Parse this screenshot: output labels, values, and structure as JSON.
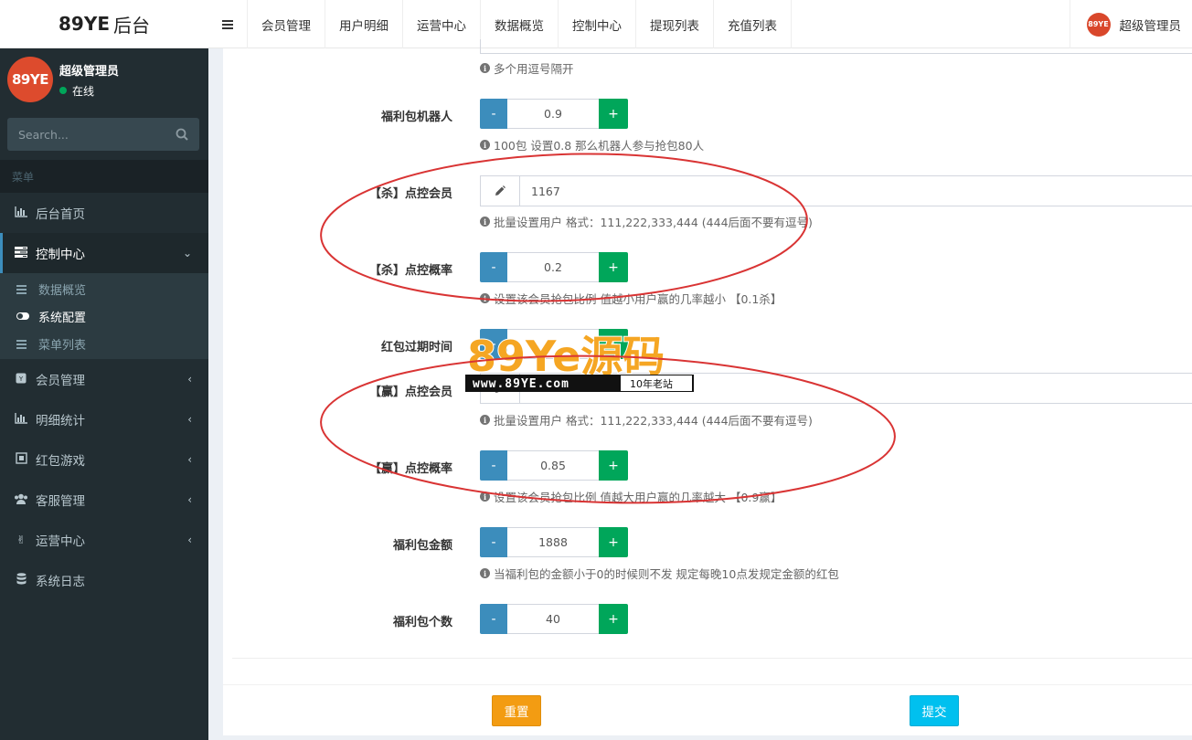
{
  "brand": {
    "strong": "89YE",
    "suffix": "后台",
    "avatar_text": "89YE"
  },
  "topnav": {
    "items": [
      "会员管理",
      "用户明细",
      "运营中心",
      "数据概览",
      "控制中心",
      "提现列表",
      "充值列表"
    ],
    "user_name": "超级管理员"
  },
  "sidebar": {
    "user_name": "超级管理员",
    "status": "在线",
    "search_placeholder": "Search...",
    "menu_header": "菜单",
    "items": [
      {
        "label": "后台首页",
        "icon": "bar-chart-icon"
      },
      {
        "label": "控制中心",
        "icon": "tasks-icon"
      },
      {
        "label": "会员管理",
        "icon": "badge-icon"
      },
      {
        "label": "明细统计",
        "icon": "bar-chart-icon"
      },
      {
        "label": "红包游戏",
        "icon": "frame-icon"
      },
      {
        "label": "客服管理",
        "icon": "users-icon"
      },
      {
        "label": "运营中心",
        "icon": "hand-peace-icon"
      },
      {
        "label": "系统日志",
        "icon": "database-icon"
      }
    ],
    "submenu": [
      {
        "label": "数据概览",
        "icon": "list-icon"
      },
      {
        "label": "系统配置",
        "icon": "toggle-icon"
      },
      {
        "label": "菜单列表",
        "icon": "list-icon"
      }
    ]
  },
  "form": {
    "top_help": "多个用逗号隔开",
    "robot": {
      "label": "福利包机器人",
      "value": "0.9",
      "help": "100包 设置0.8 那么机器人参与抢包80人"
    },
    "kill_member": {
      "label": "【杀】点控会员",
      "value": "1167",
      "help": "批量设置用户 格式：111,222,333,444 (444后面不要有逗号)"
    },
    "kill_rate": {
      "label": "【杀】点控概率",
      "value": "0.2",
      "help": "设置该会员抢包比例 值越小用户赢的几率越小 【0.1杀】"
    },
    "expire": {
      "label": "红包过期时间"
    },
    "win_member": {
      "label": "【赢】点控会员",
      "value": "",
      "help": "批量设置用户 格式：111,222,333,444 (444后面不要有逗号)"
    },
    "win_rate": {
      "label": "【赢】点控概率",
      "value": "0.85",
      "help": "设置该会员抢包比例 值越大用户赢的几率越大 【0.9赢】"
    },
    "amount": {
      "label": "福利包金额",
      "value": "1888",
      "help": "当福利包的金额小于0的时候则不发 规定每晚10点发规定金额的红包"
    },
    "count": {
      "label": "福利包个数",
      "value": "40"
    },
    "minus": "-",
    "plus": "+",
    "reset": "重置",
    "submit": "提交"
  },
  "watermark": {
    "title": "89Ye源码",
    "url": "www.89YE.com",
    "tag": "10年老站"
  },
  "colors": {
    "primary": "#3c8dbc",
    "success": "#00a65a",
    "warning": "#f39c12",
    "info": "#00c0ef",
    "sidebar": "#222d32",
    "annotation": "#d93434"
  }
}
